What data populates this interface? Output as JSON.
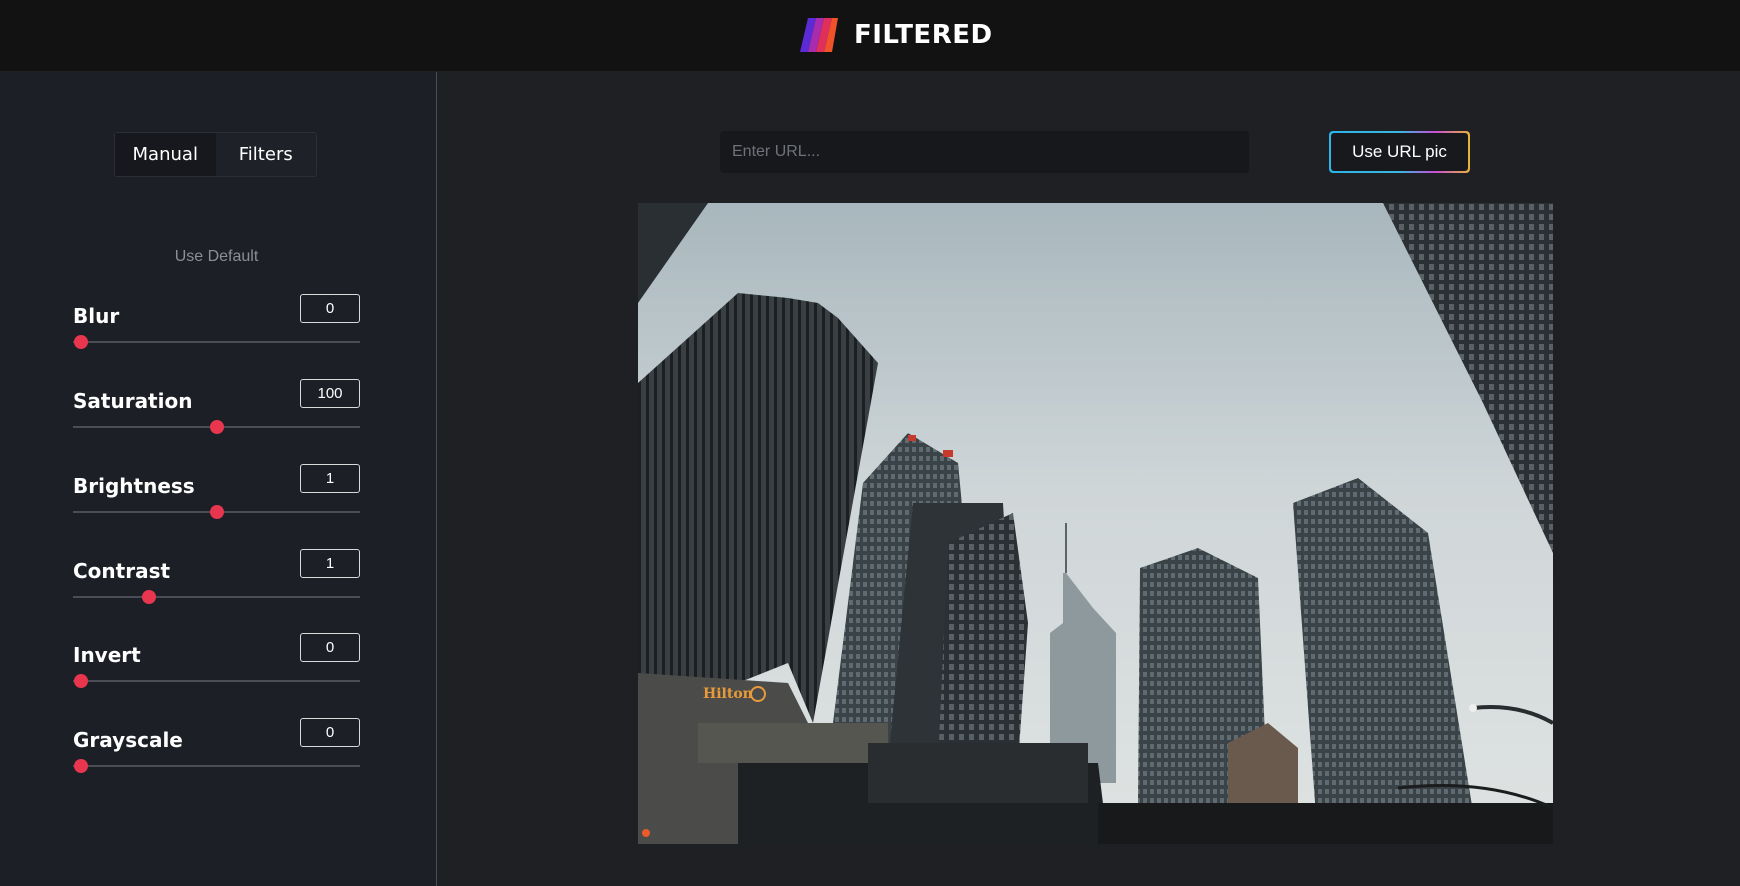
{
  "header": {
    "brand_name": "FILTERED",
    "logo_icon": "striped-logo-icon"
  },
  "sidebar": {
    "tabs": [
      {
        "label": "Manual",
        "active": true
      },
      {
        "label": "Filters",
        "active": false
      }
    ],
    "use_default_label": "Use Default",
    "controls": [
      {
        "label": "Blur",
        "value": "0",
        "min": 0,
        "max": 20,
        "level": 0.0
      },
      {
        "label": "Saturation",
        "value": "100",
        "min": 0,
        "max": 200,
        "level": 0.5
      },
      {
        "label": "Brightness",
        "value": "1",
        "min": 0,
        "max": 2,
        "level": 0.5
      },
      {
        "label": "Contrast",
        "value": "1",
        "min": 0,
        "max": 4,
        "level": 0.25
      },
      {
        "label": "Invert",
        "value": "0",
        "min": 0,
        "max": 1,
        "level": 0.0
      },
      {
        "label": "Grayscale",
        "value": "0",
        "min": 0,
        "max": 1,
        "level": 0.0
      }
    ]
  },
  "main": {
    "url_input": {
      "value": "",
      "placeholder": "Enter URL..."
    },
    "url_button_label": "Use URL pic",
    "preview": {
      "description_icon": "city-skyscrapers-image",
      "hotel_sign": "Hilton"
    }
  },
  "colors": {
    "accent": "#e8364f",
    "header_bg": "#121212",
    "sidebar_bg": "#1c1f26",
    "main_bg": "#1f2024"
  }
}
